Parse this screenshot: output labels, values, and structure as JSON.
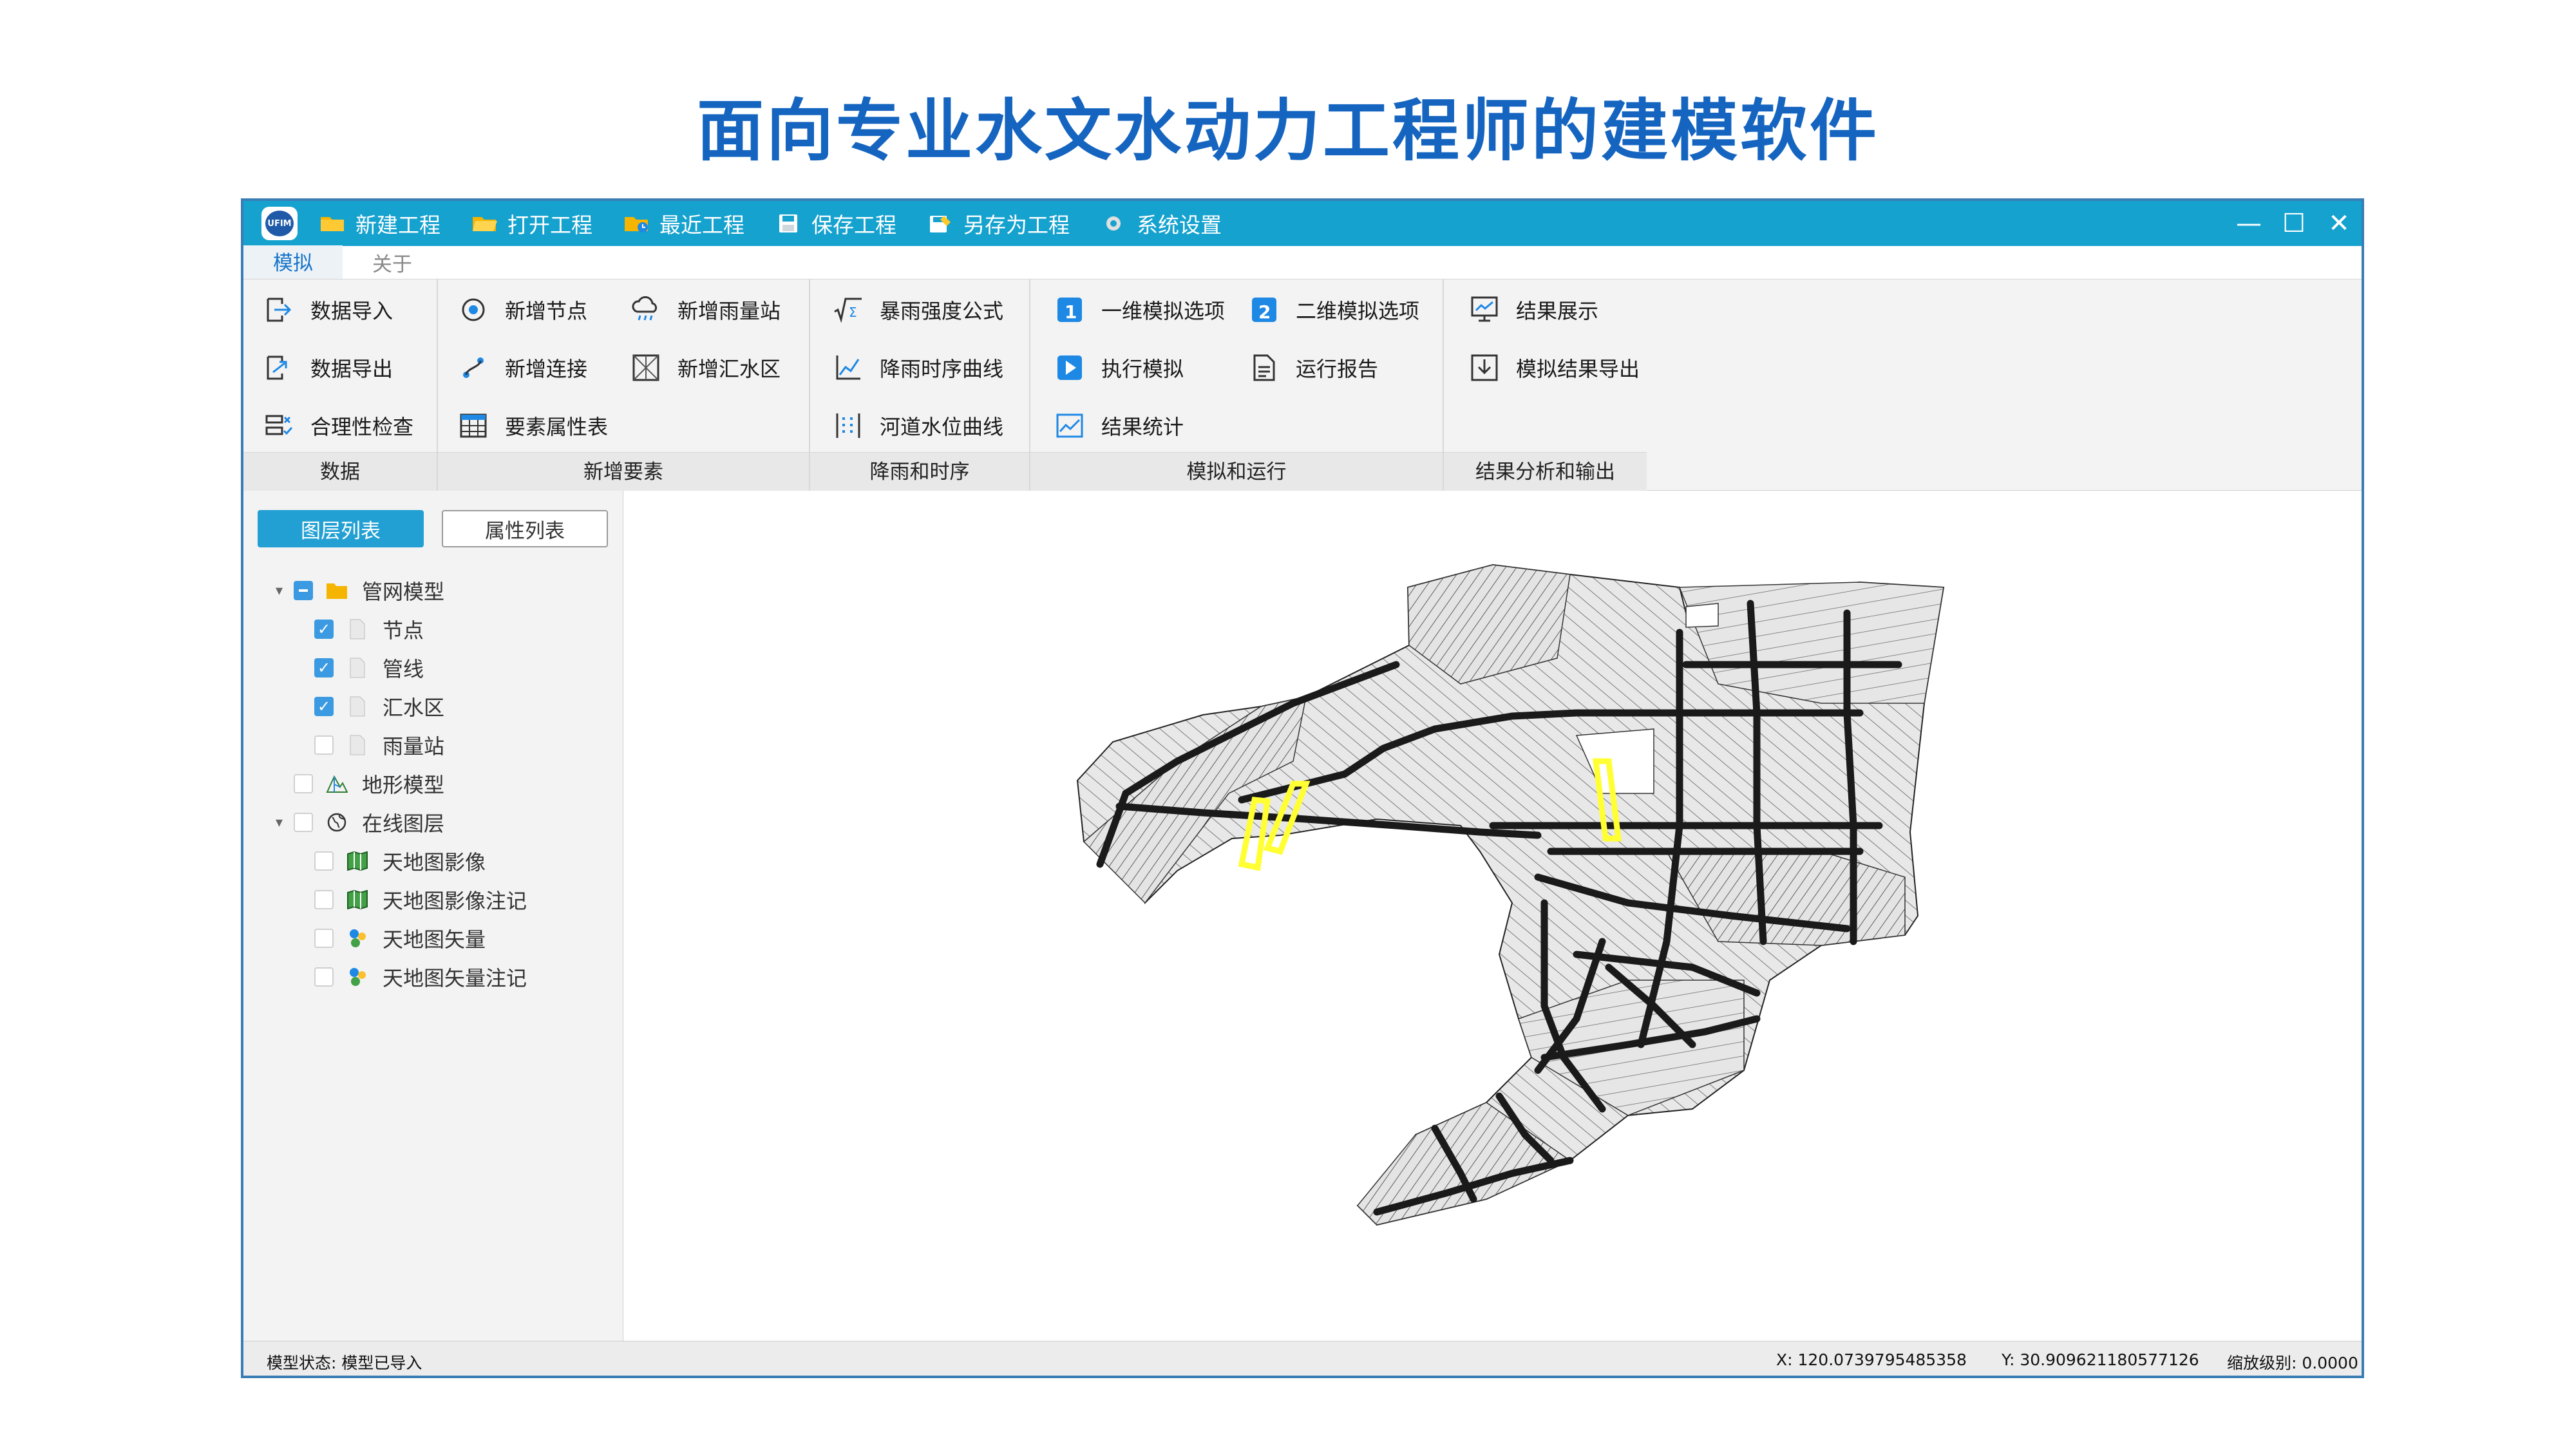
{
  "slide": {
    "title": "面向专业水文水动力工程师的建模软件"
  },
  "titlebar": {
    "logo_text": "UFIM",
    "quick_actions": [
      {
        "label": "新建工程",
        "icon": "folder-new-icon"
      },
      {
        "label": "打开工程",
        "icon": "folder-open-icon"
      },
      {
        "label": "最近工程",
        "icon": "folder-recent-icon"
      },
      {
        "label": "保存工程",
        "icon": "save-icon"
      },
      {
        "label": "另存为工程",
        "icon": "save-as-icon"
      },
      {
        "label": "系统设置",
        "icon": "gear-icon"
      }
    ],
    "controls": {
      "minimize": "—",
      "maximize": "☐",
      "close": "✕"
    }
  },
  "tabs": [
    {
      "label": "模拟",
      "active": true
    },
    {
      "label": "关于",
      "active": false
    }
  ],
  "ribbon": {
    "groups": [
      {
        "label": "数据",
        "buttons": [
          "数据导入",
          "数据导出",
          "合理性检查"
        ]
      },
      {
        "label": "新增要素",
        "buttons": [
          "新增节点",
          "新增雨量站",
          "新增连接",
          "新增汇水区",
          "要素属性表"
        ]
      },
      {
        "label": "降雨和时序",
        "buttons": [
          "暴雨强度公式",
          "降雨时序曲线",
          "河道水位曲线"
        ]
      },
      {
        "label": "模拟和运行",
        "buttons": [
          "一维模拟选项",
          "二维模拟选项",
          "执行模拟",
          "运行报告",
          "结果统计"
        ]
      },
      {
        "label": "结果分析和输出",
        "buttons": [
          "结果展示",
          "模拟结果导出"
        ]
      }
    ]
  },
  "left_panel": {
    "tabs": [
      "图层列表",
      "属性列表"
    ],
    "tree": [
      {
        "label": "管网模型",
        "checked": "partial",
        "icon": "folder-icon"
      },
      {
        "label": "节点",
        "checked": true,
        "icon": "file-icon"
      },
      {
        "label": "管线",
        "checked": true,
        "icon": "file-icon"
      },
      {
        "label": "汇水区",
        "checked": true,
        "icon": "file-icon"
      },
      {
        "label": "雨量站",
        "checked": false,
        "icon": "file-icon"
      },
      {
        "label": "地形模型",
        "checked": false,
        "icon": "terrain-icon"
      },
      {
        "label": "在线图层",
        "checked": false,
        "icon": "globe-icon"
      },
      {
        "label": "天地图影像",
        "checked": false,
        "icon": "map-image-icon"
      },
      {
        "label": "天地图影像注记",
        "checked": false,
        "icon": "map-image-icon"
      },
      {
        "label": "天地图矢量",
        "checked": false,
        "icon": "map-vector-icon"
      },
      {
        "label": "天地图矢量注记",
        "checked": false,
        "icon": "map-vector-icon"
      }
    ]
  },
  "status": {
    "model_state": "模型状态: 模型已导入",
    "x": "X: 120.0739795485358",
    "y": "Y: 30.909621180577126",
    "zoom": "缩放级别: 0.0000"
  },
  "colors": {
    "title_blue": "#1565c0",
    "titlebar": "#15a2cf",
    "accent": "#22a0d3",
    "highlight_yellow": "#ffff33"
  }
}
